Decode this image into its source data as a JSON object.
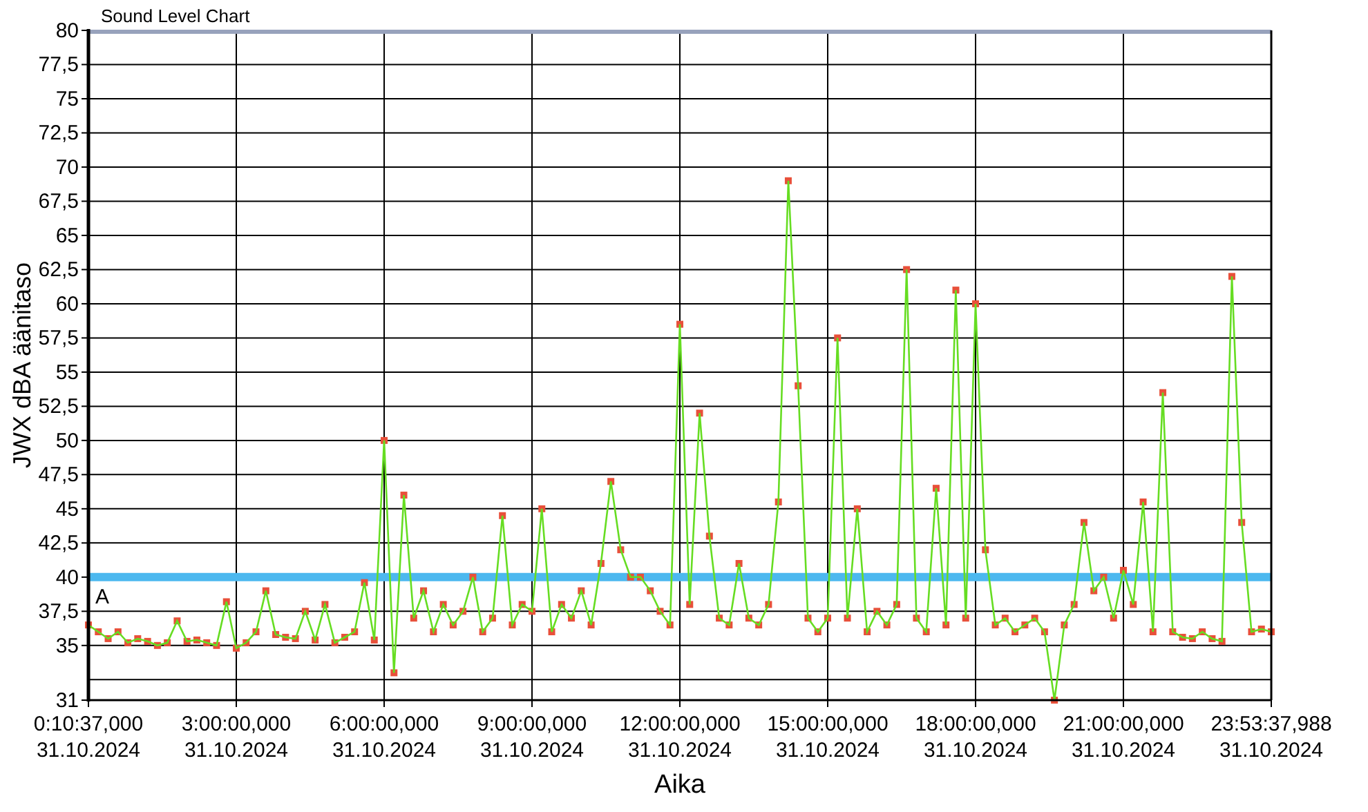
{
  "chart_data": {
    "type": "line",
    "title": "Sound Level Chart",
    "xlabel": "Aika",
    "ylabel": "JWX dBA äänitaso",
    "categories": [
      "0:10:37,000\n31.10.2024",
      null,
      null,
      null,
      null,
      null,
      null,
      null,
      null,
      null,
      null,
      null,
      null,
      null,
      null,
      "3:00:00,000\n31.10.2024",
      null,
      null,
      null,
      null,
      null,
      null,
      null,
      null,
      null,
      null,
      null,
      null,
      null,
      null,
      "6:00:00,000\n31.10.2024",
      null,
      null,
      null,
      null,
      null,
      null,
      null,
      null,
      null,
      null,
      null,
      null,
      null,
      null,
      "9:00:00,000\n31.10.2024",
      null,
      null,
      null,
      null,
      null,
      null,
      null,
      null,
      null,
      null,
      null,
      null,
      null,
      null,
      "12:00:00,000\n31.10.2024",
      null,
      null,
      null,
      null,
      null,
      null,
      null,
      null,
      null,
      null,
      null,
      null,
      null,
      null,
      "15:00:00,000\n31.10.2024",
      null,
      null,
      null,
      null,
      null,
      null,
      null,
      null,
      null,
      null,
      null,
      null,
      null,
      null,
      "18:00:00,000\n31.10.2024",
      null,
      null,
      null,
      null,
      null,
      null,
      null,
      null,
      null,
      null,
      null,
      null,
      null,
      null,
      "21:00:00,000\n31.10.2024",
      null,
      null,
      null,
      null,
      null,
      null,
      null,
      null,
      null,
      null,
      null,
      null,
      null,
      null,
      "23:53:37,988\n31.10.2024"
    ],
    "series": [
      {
        "color": "#66dd22",
        "marker": "square",
        "values": [
          36.5,
          36,
          35.5,
          36,
          35.2,
          35.5,
          35.3,
          35,
          35.2,
          36.8,
          35.3,
          35.4,
          35.2,
          35,
          38.2,
          34.8,
          35.2,
          36,
          39,
          35.8,
          35.6,
          35.5,
          37.5,
          35.4,
          38,
          35.2,
          35.6,
          36,
          39.6,
          35.4,
          50,
          33,
          46,
          37,
          39,
          36,
          38,
          36.5,
          37.5,
          40,
          36,
          37,
          44.5,
          36.5,
          38,
          37.5,
          45,
          36,
          38,
          37,
          39,
          36.5,
          41,
          47,
          42,
          40,
          40,
          39,
          37.5,
          36.5,
          58.5,
          38,
          52,
          43,
          37,
          36.5,
          41,
          37,
          36.5,
          38,
          45.5,
          69,
          54,
          37,
          36,
          37,
          57.5,
          37,
          45,
          36,
          37.5,
          36.5,
          38,
          62.5,
          37,
          36,
          46.5,
          36.5,
          61,
          37,
          60,
          42,
          36.5,
          37,
          36,
          36.5,
          37,
          36,
          31,
          36.5,
          38,
          44,
          39,
          40,
          37,
          40.5,
          38,
          45.5,
          36,
          53.5,
          36,
          35.6,
          35.5,
          36,
          35.5,
          35.3,
          62,
          44,
          36,
          36.2,
          36
        ]
      }
    ],
    "ylim": [
      31,
      80
    ],
    "grid": true,
    "yticks": [
      {
        "value": 31,
        "label": "31"
      },
      {
        "value": 35,
        "label": "35"
      },
      {
        "value": 37.5,
        "label": "37,5"
      },
      {
        "value": 40,
        "label": "40"
      },
      {
        "value": 42.5,
        "label": "42,5"
      },
      {
        "value": 45,
        "label": "45"
      },
      {
        "value": 47.5,
        "label": "47,5"
      },
      {
        "value": 50,
        "label": "50"
      },
      {
        "value": 52.5,
        "label": "52,5"
      },
      {
        "value": 55,
        "label": "55"
      },
      {
        "value": 57.5,
        "label": "57,5"
      },
      {
        "value": 60,
        "label": "60"
      },
      {
        "value": 62.5,
        "label": "62,5"
      },
      {
        "value": 65,
        "label": "65"
      },
      {
        "value": 67.5,
        "label": "67,5"
      },
      {
        "value": 70,
        "label": "70"
      },
      {
        "value": 72.5,
        "label": "72,5"
      },
      {
        "value": 75,
        "label": "75"
      },
      {
        "value": 77.5,
        "label": "77,5"
      },
      {
        "value": 80,
        "label": "80"
      }
    ],
    "ref_lines": [
      {
        "axis": "y",
        "value": 40,
        "color": "#4cb8ef",
        "label": "A"
      }
    ]
  }
}
